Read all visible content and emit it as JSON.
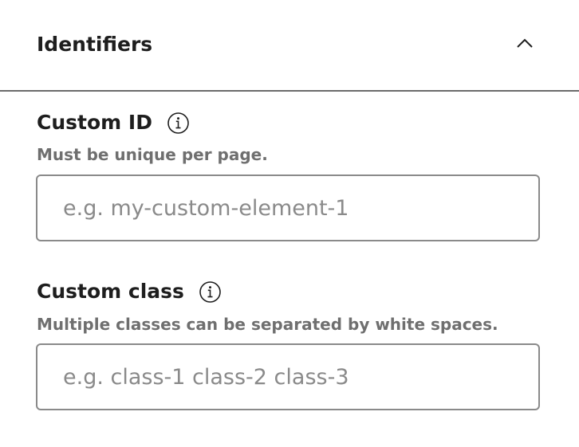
{
  "panel": {
    "title": "Identifiers",
    "state": "expanded",
    "toggle_icon": "chevron-up-icon"
  },
  "fields": {
    "custom_id": {
      "label": "Custom ID",
      "info_icon": "info-icon",
      "help": "Must be unique per page.",
      "value": "",
      "placeholder": "e.g. my-custom-element-1"
    },
    "custom_class": {
      "label": "Custom class",
      "info_icon": "info-icon",
      "help": "Multiple classes can be separated by white spaces.",
      "value": "",
      "placeholder": "e.g. class-1 class-2 class-3"
    }
  },
  "colors": {
    "text": "#1e1e1e",
    "help_text": "#6f6f6f",
    "border": "#8a8a8a",
    "divider": "#6b6b6b",
    "background": "#ffffff"
  }
}
